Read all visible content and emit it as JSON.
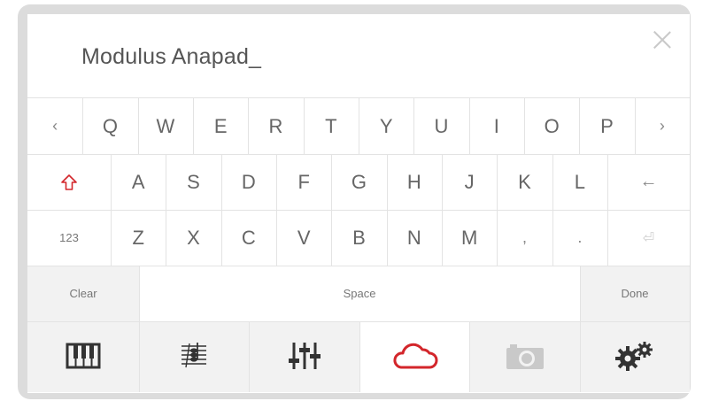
{
  "input": {
    "value": "Modulus Anapad_"
  },
  "keyboard": {
    "row1": [
      "‹",
      "Q",
      "W",
      "E",
      "R",
      "T",
      "Y",
      "U",
      "I",
      "O",
      "P",
      "›"
    ],
    "row2": [
      "A",
      "S",
      "D",
      "F",
      "G",
      "H",
      "J",
      "K",
      "L"
    ],
    "row3": [
      "Z",
      "X",
      "C",
      "V",
      "B",
      "N",
      "M",
      ",",
      "."
    ],
    "numbers_label": "123",
    "clear_label": "Clear",
    "space_label": "Space",
    "done_label": "Done",
    "backspace_glyph": "←",
    "enter_glyph": "⏎"
  },
  "tabs": [
    {
      "name": "piano-icon"
    },
    {
      "name": "notation-icon"
    },
    {
      "name": "mixer-sliders-icon"
    },
    {
      "name": "cloud-icon",
      "active": true
    },
    {
      "name": "camera-icon",
      "disabled": true
    },
    {
      "name": "gear-icon"
    }
  ],
  "colors": {
    "accent": "#d3262b",
    "border": "#e3e3e3",
    "gray_key": "#f2f2f2",
    "text": "#666666"
  }
}
